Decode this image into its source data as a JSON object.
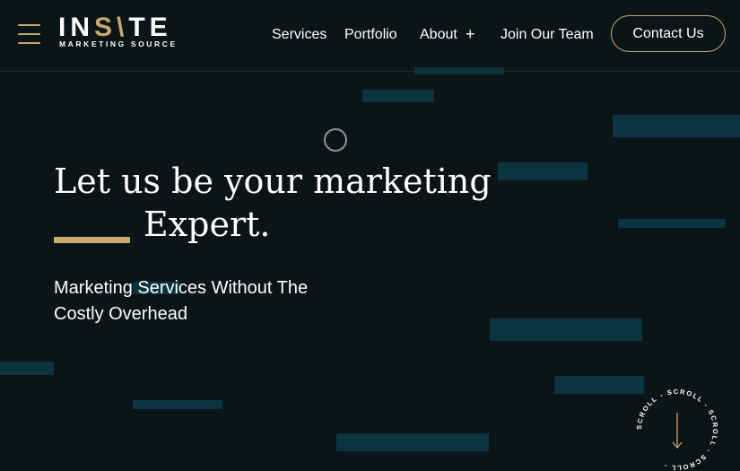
{
  "header": {
    "logo": {
      "word_part1": "IN",
      "word_slash": "S\\",
      "word_part2": "TE",
      "tagline": "MARKETING SOURCE"
    },
    "nav": [
      {
        "label": "Services"
      },
      {
        "label": "Portfolio"
      },
      {
        "label": "About"
      },
      {
        "label": "Join Our Team"
      }
    ],
    "about_expand_icon": "plus-icon",
    "menu_icon": "hamburger-menu-icon",
    "contact_label": "Contact Us"
  },
  "hero": {
    "headline_line1": "Let us be your marketing",
    "headline_line2": "Expert.",
    "subtitle": "Marketing Services Without The Costly Overhead"
  },
  "scroll": {
    "label": "SCROLL",
    "icon": "arrow-down-icon"
  },
  "colors": {
    "background": "#0b1417",
    "accent_gold": "#c9a96e",
    "deco_teal": "#0c3340",
    "text": "#ffffff"
  }
}
